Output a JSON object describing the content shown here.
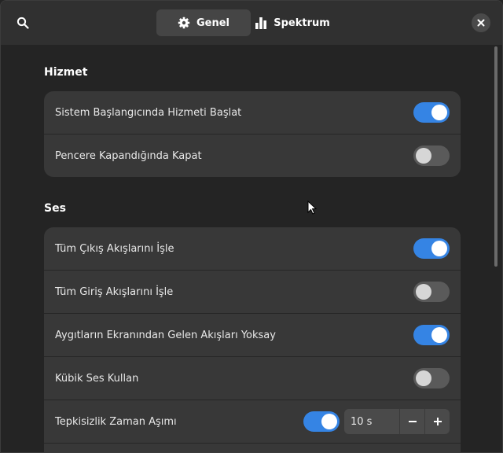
{
  "header": {
    "tabs": [
      {
        "label": "Genel",
        "icon": "gear-icon",
        "active": true
      },
      {
        "label": "Spektrum",
        "icon": "bar-chart-icon",
        "active": false
      }
    ]
  },
  "sections": {
    "service": {
      "title": "Hizmet",
      "rows": [
        {
          "label": "Sistem Başlangıcında Hizmeti Başlat",
          "enabled": true
        },
        {
          "label": "Pencere Kapandığında Kapat",
          "enabled": false
        }
      ]
    },
    "audio": {
      "title": "Ses",
      "rows": [
        {
          "label": "Tüm Çıkış Akışlarını İşle",
          "enabled": true
        },
        {
          "label": "Tüm Giriş Akışlarını İşle",
          "enabled": false
        },
        {
          "label": "Aygıtların Ekranından Gelen Akışları Yoksay",
          "enabled": true
        },
        {
          "label": "Kübik Ses Kullan",
          "enabled": false
        },
        {
          "label": "Tepkisizlik Zaman Aşımı",
          "enabled": true,
          "value": "10 s"
        }
      ]
    }
  },
  "colors": {
    "accent": "#3584e4",
    "background": "#242424",
    "card": "#383838"
  }
}
